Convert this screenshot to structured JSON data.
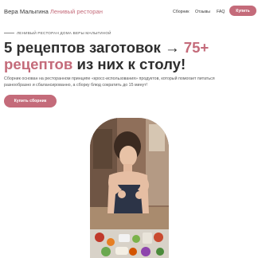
{
  "header": {
    "brand_name": "Вера Малыгина",
    "brand_accent": "Ленивый ресторан",
    "nav": [
      "Сборник",
      "Отзывы",
      "FAQ"
    ],
    "buy_label": "Купить"
  },
  "hero": {
    "eyebrow": "ЛЕНИВЫЙ РЕСТОРАН ДОМА ВЕРЫ МАЛЫГИНОЙ",
    "headline_part1": "5 рецептов заготовок → ",
    "headline_num": "75+",
    "headline_part2": "рецептов",
    "headline_part3": " из них к столу!",
    "description": "Сборник основан на ресторанном принципе «кросс-использования» продуктов, который помогает питаться разнообразно и сбалансированно, а сборку блюд сократить до 15 минут!",
    "cta_label": "Купить сборник"
  },
  "colors": {
    "accent": "#c46b7a",
    "text": "#2e2e2e",
    "background": "#ffffff"
  }
}
